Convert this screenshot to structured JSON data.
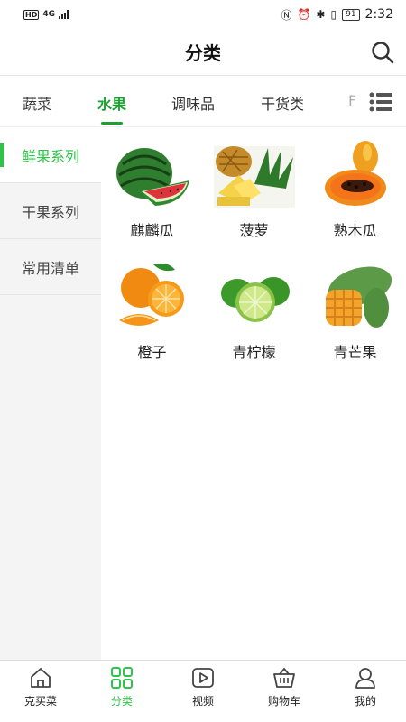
{
  "status_bar": {
    "hd": "HD",
    "network": "4G",
    "battery": "91",
    "time": "2:32"
  },
  "header": {
    "title": "分类"
  },
  "tabs": [
    {
      "label": "蔬菜"
    },
    {
      "label": "水果"
    },
    {
      "label": "调味品"
    },
    {
      "label": "干货类"
    },
    {
      "label": "F"
    }
  ],
  "sidebar": {
    "items": [
      {
        "label": "鲜果系列"
      },
      {
        "label": "干果系列"
      },
      {
        "label": "常用清单"
      }
    ]
  },
  "products": [
    {
      "name": "麒麟瓜",
      "icon": "watermelon"
    },
    {
      "name": "菠萝",
      "icon": "pineapple"
    },
    {
      "name": "熟木瓜",
      "icon": "papaya"
    },
    {
      "name": "橙子",
      "icon": "orange"
    },
    {
      "name": "青柠檬",
      "icon": "lime"
    },
    {
      "name": "青芒果",
      "icon": "mango"
    }
  ],
  "bottom_nav": [
    {
      "label": "克买菜",
      "icon": "home-icon"
    },
    {
      "label": "分类",
      "icon": "grid-icon"
    },
    {
      "label": "视频",
      "icon": "video-icon"
    },
    {
      "label": "购物车",
      "icon": "cart-icon"
    },
    {
      "label": "我的",
      "icon": "user-icon"
    }
  ],
  "colors": {
    "accent": "#1aa130",
    "sidebar_active": "#2ec44a",
    "sidebar_bg": "#f4f4f4"
  }
}
